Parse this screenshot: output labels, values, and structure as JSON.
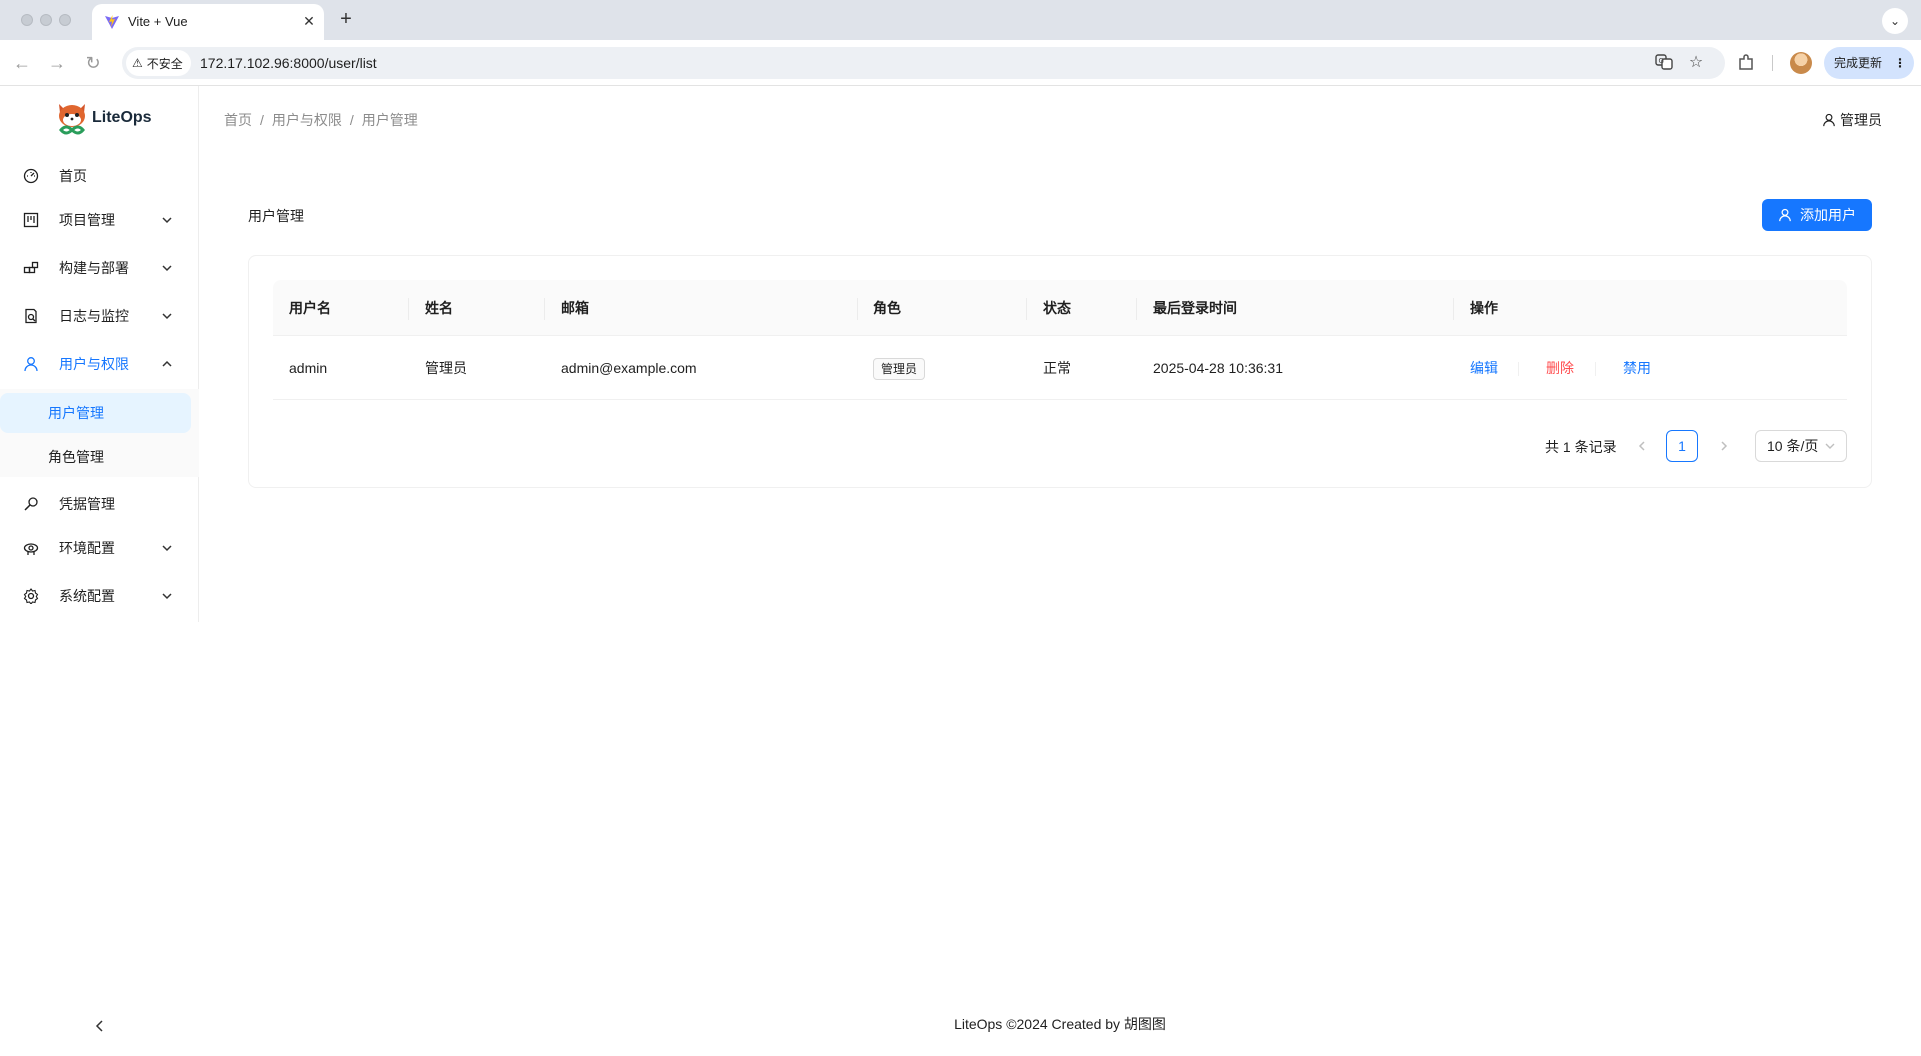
{
  "browser": {
    "tab_title": "Vite + Vue",
    "security_label": "不安全",
    "url": "172.17.102.96:8000/user/list",
    "update_label": "完成更新"
  },
  "app": {
    "logo_text": "LiteOps",
    "breadcrumb": [
      "首页",
      "用户与权限",
      "用户管理"
    ],
    "breadcrumb_sep": "/",
    "user_name": "管理员"
  },
  "sidebar": {
    "items": [
      {
        "label": "首页",
        "icon": "dashboard-icon"
      },
      {
        "label": "项目管理",
        "icon": "project-icon"
      },
      {
        "label": "构建与部署",
        "icon": "build-icon"
      },
      {
        "label": "日志与监控",
        "icon": "log-monitor-icon"
      },
      {
        "label": "用户与权限",
        "icon": "user-icon"
      },
      {
        "label": "凭据管理",
        "icon": "key-icon"
      },
      {
        "label": "环境配置",
        "icon": "environment-icon"
      },
      {
        "label": "系统配置",
        "icon": "settings-icon"
      }
    ],
    "sub_items": [
      {
        "label": "用户管理"
      },
      {
        "label": "角色管理"
      }
    ]
  },
  "page": {
    "title": "用户管理",
    "add_button": "添加用户"
  },
  "table": {
    "columns": [
      "用户名",
      "姓名",
      "邮箱",
      "角色",
      "状态",
      "最后登录时间",
      "操作"
    ],
    "rows": [
      {
        "username": "admin",
        "name": "管理员",
        "email": "admin@example.com",
        "role": "管理员",
        "status": "正常",
        "last_login": "2025-04-28 10:36:31",
        "actions": [
          "编辑",
          "删除",
          "禁用"
        ]
      }
    ]
  },
  "pagination": {
    "total_text": "共 1 条记录",
    "current_page": "1",
    "page_size": "10 条/页"
  },
  "footer": "LiteOps ©2024 Created by 胡图图",
  "colors": {
    "primary": "#1677ff",
    "danger": "#ff4d4f"
  }
}
